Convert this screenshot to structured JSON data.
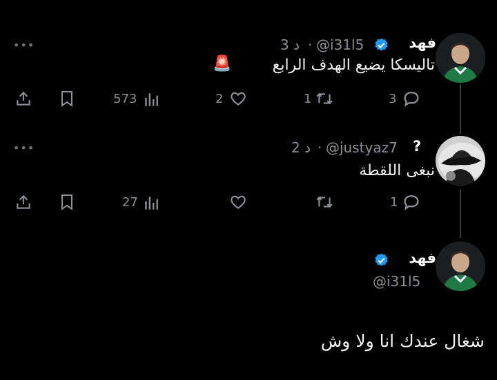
{
  "tweet1": {
    "name": "فهد",
    "handle": "@i31l5",
    "time": "3 د",
    "separator": "·",
    "text": "تاليسكا يضيع الهدف الرابع",
    "emoji": "🚨",
    "replies": "3",
    "retweets": "1",
    "likes": "2",
    "views": "573",
    "more": "•••"
  },
  "tweet2": {
    "name": "?",
    "handle": "@justyaz7",
    "time": "2 د",
    "separator": "·",
    "text": "نبغى اللقطة",
    "replies": "1",
    "views": "27",
    "more": "•••"
  },
  "reply": {
    "name": "فهد",
    "handle": "@i31l5",
    "text": "شغال عندك انا ولا وش"
  },
  "colors": {
    "background": "#000000",
    "verified": "#1d9bf0",
    "muted": "#71767b",
    "text": "#e7e9ea"
  }
}
